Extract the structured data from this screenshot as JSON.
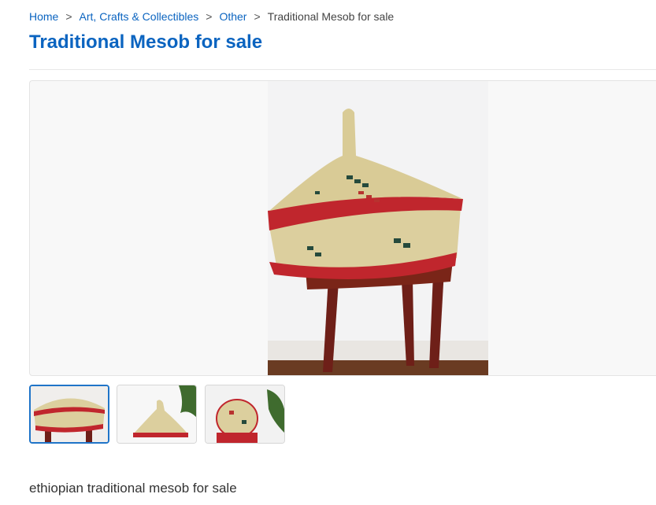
{
  "breadcrumb": {
    "items": [
      "Home",
      "Art, Crafts & Collectibles",
      "Other"
    ],
    "separator": ">",
    "current": "Traditional Mesob for sale"
  },
  "listing": {
    "title": "Traditional Mesob for sale",
    "description": "ethiopian traditional mesob for sale"
  },
  "gallery": {
    "active_index": 0,
    "thumbnail_count": 3
  },
  "colors": {
    "link": "#0b64c0",
    "title": "#0b64c0",
    "active_thumb_border": "#1f74c8",
    "basket_red": "#c0262d",
    "straw": "#dccf9e"
  }
}
